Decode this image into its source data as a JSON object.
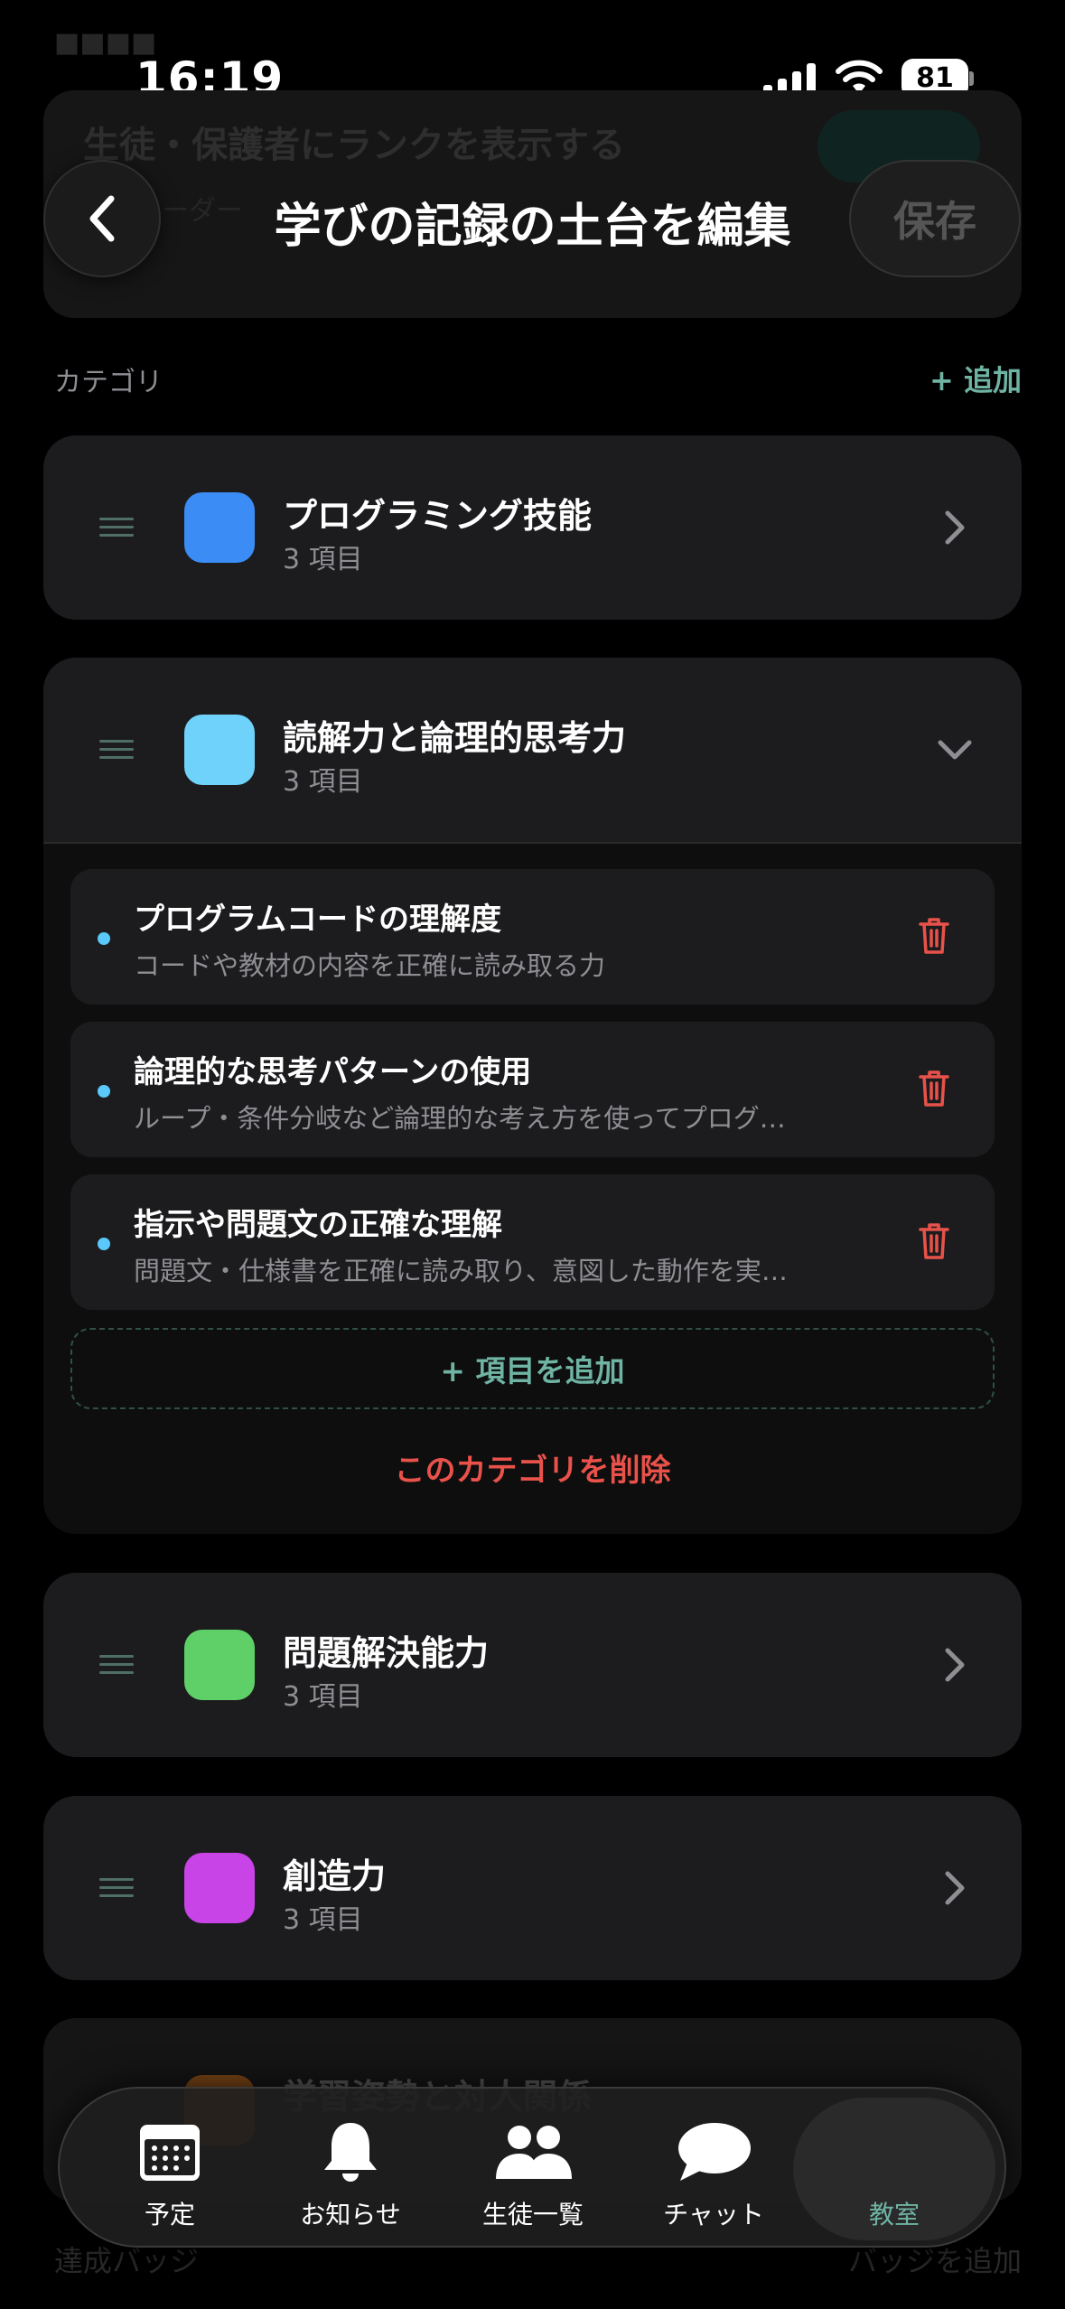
{
  "status_bar": {
    "time": "16:19",
    "battery": "81"
  },
  "header": {
    "title": "学びの記録の土台を編集",
    "save_label": "保存"
  },
  "ghost": {
    "title": "生徒・保護者にランクを表示する",
    "line": "す。レーダー"
  },
  "section": {
    "label": "カテゴリ",
    "add_label": "+ 追加"
  },
  "categories": [
    {
      "name": "プログラミング技能",
      "count": "3 項目",
      "color": "#3b8cf5"
    },
    {
      "name": "読解力と論理的思考力",
      "count": "3 項目",
      "color": "#6fd2fb"
    },
    {
      "name": "問題解決能力",
      "count": "3 項目",
      "color": "#5fd067"
    },
    {
      "name": "創造力",
      "count": "3 項目",
      "color": "#c944e6"
    },
    {
      "name": "学習姿勢と対人関係",
      "color": "#b5651d"
    }
  ],
  "expanded_items": [
    {
      "title": "プログラムコードの理解度",
      "desc": "コードや教材の内容を正確に読み取る力"
    },
    {
      "title": "論理的な思考パターンの使用",
      "desc": "ループ・条件分岐など論理的な考え方を使ってプログ…"
    },
    {
      "title": "指示や問題文の正確な理解",
      "desc": "問題文・仕様書を正確に読み取り、意図した動作を実…"
    }
  ],
  "add_item_label": "+ 項目を追加",
  "delete_category_label": "このカテゴリを削除",
  "bottom_ghost": {
    "left": "達成バッジ",
    "right": "バッジを追加"
  },
  "tabs": [
    {
      "label": "予定",
      "icon": "calendar-icon"
    },
    {
      "label": "お知らせ",
      "icon": "bell-icon"
    },
    {
      "label": "生徒一覧",
      "icon": "people-icon"
    },
    {
      "label": "チャット",
      "icon": "chat-bubble-icon"
    },
    {
      "label": "教室",
      "icon": "classroom-icon"
    }
  ],
  "colors": {
    "accent": "#6fb3a3",
    "danger": "#e8524a"
  }
}
